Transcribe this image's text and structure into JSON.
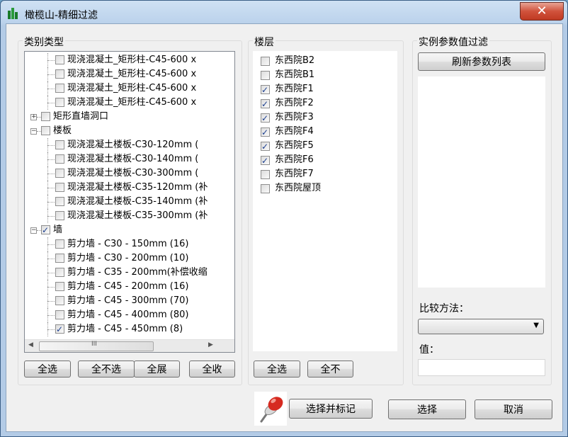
{
  "window": {
    "title": "橄榄山-精细过滤",
    "close_symbol": "✕"
  },
  "category": {
    "group_label": "类别类型",
    "rows": [
      {
        "text": "现浇混凝土_矩形柱-C45-600 x",
        "checked": false
      },
      {
        "text": "现浇混凝土_矩形柱-C45-600 x",
        "checked": false
      },
      {
        "text": "现浇混凝土_矩形柱-C45-600 x",
        "checked": false
      },
      {
        "text": "现浇混凝土_矩形柱-C45-600 x",
        "checked": false
      },
      {
        "text": "矩形直墙洞口",
        "checked": false
      },
      {
        "text": "楼板",
        "checked": false
      },
      {
        "text": "现浇混凝土楼板-C30-120mm   (",
        "checked": false
      },
      {
        "text": "现浇混凝土楼板-C30-140mm   (",
        "checked": false
      },
      {
        "text": "现浇混凝土楼板-C30-300mm   (",
        "checked": false
      },
      {
        "text": "现浇混凝土楼板-C35-120mm (补",
        "checked": false
      },
      {
        "text": "现浇混凝土楼板-C35-140mm (补",
        "checked": false
      },
      {
        "text": "现浇混凝土楼板-C35-300mm (补",
        "checked": false
      },
      {
        "text": "墙",
        "checked": true
      },
      {
        "text": "剪力墙 - C30 - 150mm   (16)",
        "checked": false
      },
      {
        "text": "剪力墙 - C30 - 200mm   (10)",
        "checked": false
      },
      {
        "text": "剪力墙 - C35 - 200mm(补偿收缩",
        "checked": false
      },
      {
        "text": "剪力墙 - C45 - 200mm   (16)",
        "checked": false
      },
      {
        "text": "剪力墙 - C45 - 300mm   (70)",
        "checked": false
      },
      {
        "text": "剪力墙 - C45 - 400mm   (80)",
        "checked": false
      },
      {
        "text": "剪力墙 - C45 - 450mm   (8)",
        "checked": true
      }
    ],
    "buttons": {
      "select_all": "全选",
      "select_none": "全不选",
      "expand_all": "全展",
      "collapse_all": "全收"
    },
    "scroll_grip": "≡",
    "hscroll_grip": "III"
  },
  "floors": {
    "group_label": "楼层",
    "items": [
      {
        "text": "东西院B2",
        "checked": false
      },
      {
        "text": "东西院B1",
        "checked": false
      },
      {
        "text": "东西院F1",
        "checked": true
      },
      {
        "text": "东西院F2",
        "checked": true
      },
      {
        "text": "东西院F3",
        "checked": true
      },
      {
        "text": "东西院F4",
        "checked": true
      },
      {
        "text": "东西院F5",
        "checked": true
      },
      {
        "text": "东西院F6",
        "checked": true
      },
      {
        "text": "东西院F7",
        "checked": false
      },
      {
        "text": "东西院屋顶",
        "checked": false
      }
    ],
    "buttons": {
      "select_all": "全选",
      "select_none": "全不"
    }
  },
  "params": {
    "group_label": "实例参数值过滤",
    "refresh_button": "刷新参数列表",
    "compare_label": "比较方法：",
    "compare_value": "",
    "value_label": "值：",
    "value_input": ""
  },
  "footer": {
    "select_mark": "选择并标记",
    "select": "选择",
    "cancel": "取消"
  },
  "colors": {
    "pin_red": "#d62a20",
    "titlebar": "#bcd3ec",
    "close": "#c03a22"
  }
}
